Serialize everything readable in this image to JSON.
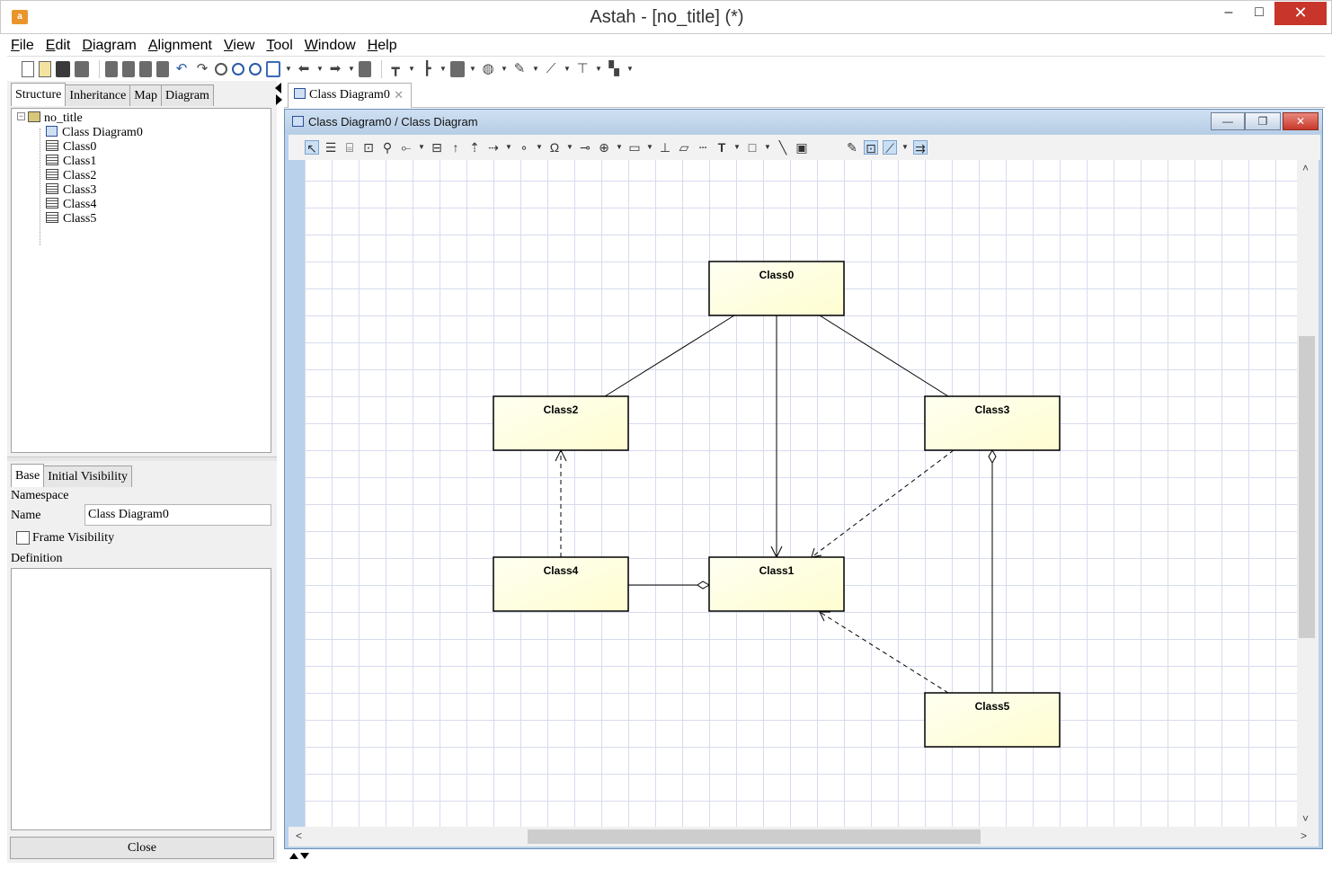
{
  "window": {
    "title": "Astah - [no_title] (*)",
    "logo": "a",
    "min_glyph": "–",
    "max_glyph": "□",
    "close_glyph": "✕"
  },
  "menu": [
    "File",
    "Edit",
    "Diagram",
    "Alignment",
    "View",
    "Tool",
    "Window",
    "Help"
  ],
  "structure_tabs": [
    "Structure",
    "Inheritance",
    "Map",
    "Diagram"
  ],
  "tree": {
    "expander": "−",
    "root": "no_title",
    "diagram": "Class Diagram0",
    "classes": [
      "Class0",
      "Class1",
      "Class2",
      "Class3",
      "Class4",
      "Class5"
    ]
  },
  "properties": {
    "tabs": [
      "Base",
      "Initial Visibility"
    ],
    "namespace_label": "Namespace",
    "name_label": "Name",
    "name_value": "Class Diagram0",
    "frame_visibility_label": "Frame Visibility",
    "frame_visibility_checked": false,
    "definition_label": "Definition",
    "close_button": "Close"
  },
  "editor": {
    "tab_label": "Class Diagram0",
    "tab_close_glyph": "✕",
    "frame_title": "Class Diagram0 / Class Diagram",
    "frame_min_glyph": "—",
    "frame_restore_glyph": "❐",
    "frame_close_glyph": "✕"
  },
  "scroll_glyphs": {
    "up": "˄",
    "down": "˅",
    "left": "˂",
    "right": "˃"
  },
  "diagram": {
    "class_fill_start": "#fffff2",
    "class_fill_end": "#fefdd0",
    "line_color": "#000000",
    "classes": [
      {
        "id": "c0",
        "name": "Class0"
      },
      {
        "id": "c1",
        "name": "Class1"
      },
      {
        "id": "c2",
        "name": "Class2"
      },
      {
        "id": "c3",
        "name": "Class3"
      },
      {
        "id": "c4",
        "name": "Class4"
      },
      {
        "id": "c5",
        "name": "Class5"
      }
    ],
    "relationships": [
      {
        "from": "Class0",
        "to": "Class2",
        "kind": "association"
      },
      {
        "from": "Class0",
        "to": "Class3",
        "kind": "association"
      },
      {
        "from": "Class0",
        "to": "Class1",
        "kind": "navigable-association"
      },
      {
        "from": "Class4",
        "to": "Class2",
        "kind": "dependency"
      },
      {
        "from": "Class3",
        "to": "Class1",
        "kind": "dependency"
      },
      {
        "from": "Class5",
        "to": "Class1",
        "kind": "dependency"
      },
      {
        "from": "Class4",
        "to": "Class1",
        "kind": "aggregation"
      },
      {
        "from": "Class5",
        "to": "Class3",
        "kind": "aggregation"
      }
    ]
  }
}
